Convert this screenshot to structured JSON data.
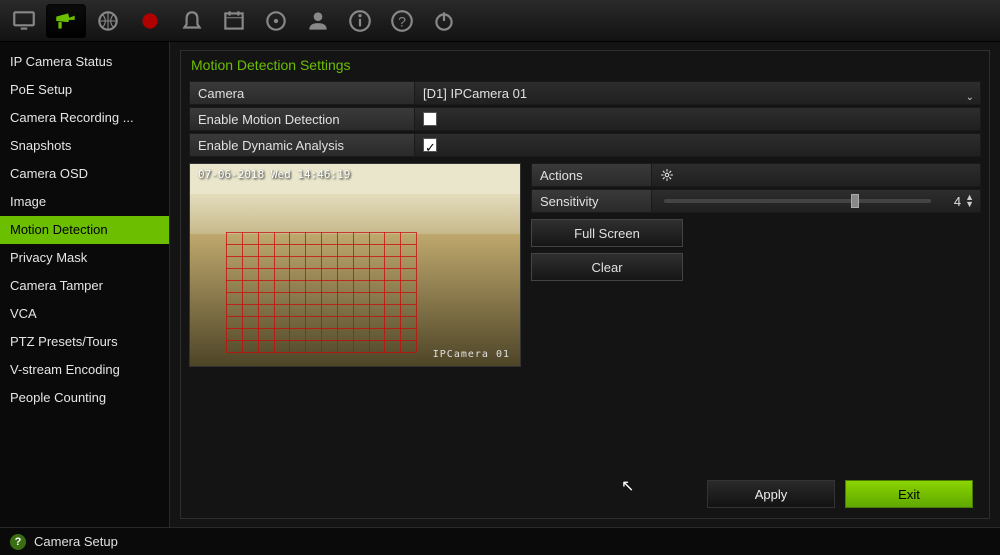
{
  "sidebar": {
    "items": [
      "IP Camera Status",
      "PoE Setup",
      "Camera Recording ...",
      "Snapshots",
      "Camera OSD",
      "Image",
      "Motion Detection",
      "Privacy Mask",
      "Camera Tamper",
      "VCA",
      "PTZ Presets/Tours",
      "V-stream Encoding",
      "People Counting"
    ],
    "active_index": 6
  },
  "page": {
    "title": "Motion Detection Settings"
  },
  "form": {
    "camera_label": "Camera",
    "camera_value": "[D1] IPCamera 01",
    "enable_motion_label": "Enable Motion Detection",
    "enable_motion_checked": false,
    "enable_dynamic_label": "Enable Dynamic Analysis",
    "enable_dynamic_checked": true
  },
  "preview": {
    "timestamp": "07-06-2018 Wed 14:46:19",
    "camera_label": "IPCamera 01"
  },
  "actions_section": {
    "actions_label": "Actions",
    "sensitivity_label": "Sensitivity",
    "sensitivity_value": "4"
  },
  "buttons": {
    "full_screen": "Full Screen",
    "clear": "Clear",
    "apply": "Apply",
    "exit": "Exit"
  },
  "footer": {
    "label": "Camera Setup"
  },
  "topbar_icons": [
    "monitor-icon",
    "camera-icon",
    "globe-icon",
    "record-icon",
    "alarm-icon",
    "schedule-icon",
    "hdd-icon",
    "user-icon",
    "info-icon",
    "help-icon",
    "power-icon"
  ]
}
